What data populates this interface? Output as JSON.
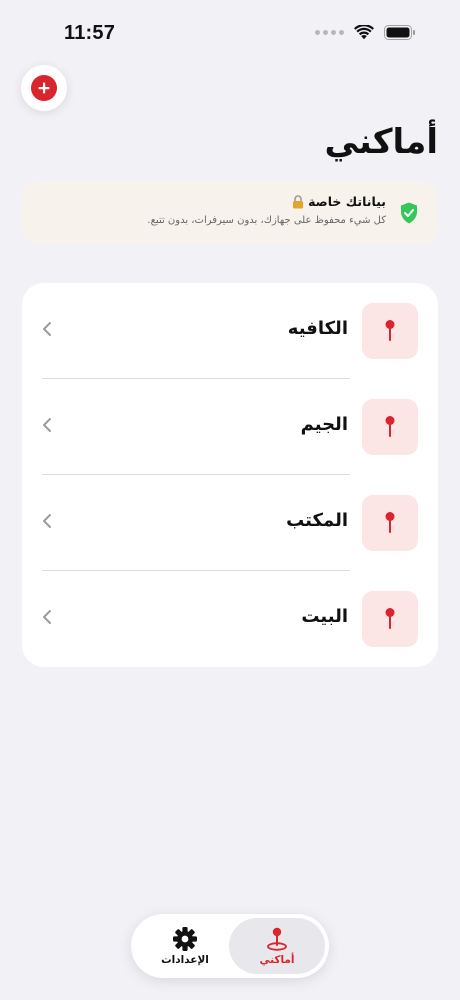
{
  "status_bar": {
    "time": "11:57"
  },
  "header": {
    "title": "أماكني",
    "add_icon": "plus-icon"
  },
  "privacy": {
    "title": "بياناتك خاصة",
    "subtitle": "كل شيء محفوظ على جهازك، بدون سيرفرات، بدون تتبع.",
    "lock_icon": "lock-icon",
    "shield_icon": "shield-check-icon",
    "shield_color": "#34c759"
  },
  "places": [
    {
      "label": "الكافيه",
      "icon": "pin-icon"
    },
    {
      "label": "الجيم",
      "icon": "pin-icon"
    },
    {
      "label": "المكتب",
      "icon": "pin-icon"
    },
    {
      "label": "البيت",
      "icon": "pin-icon"
    }
  ],
  "tabs": {
    "places": {
      "label": "أماكني",
      "icon": "location-pin-icon",
      "active": true
    },
    "settings": {
      "label": "الإعدادات",
      "icon": "gear-icon",
      "active": false
    }
  },
  "colors": {
    "accent": "#d9252b",
    "background": "#f2f1f6",
    "pin_tile": "#fbe5e5",
    "banner": "#f7f3ec"
  }
}
